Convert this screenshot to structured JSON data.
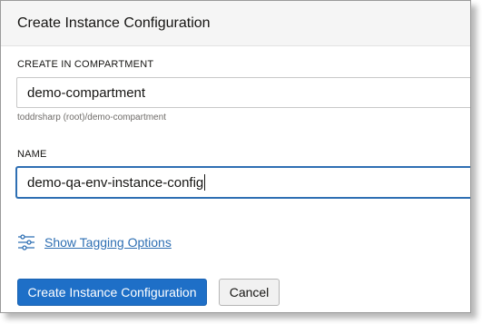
{
  "dialog": {
    "title": "Create Instance Configuration"
  },
  "compartment": {
    "label": "CREATE IN COMPARTMENT",
    "value": "demo-compartment",
    "path": "toddrsharp (root)/demo-compartment"
  },
  "name": {
    "label": "NAME",
    "value": "demo-qa-env-instance-config"
  },
  "tagging": {
    "link_label": "Show Tagging Options",
    "icon": "sliders-icon"
  },
  "actions": {
    "create_label": "Create Instance Configuration",
    "cancel_label": "Cancel"
  },
  "colors": {
    "primary": "#1e6fc7",
    "link": "#2e6fb3",
    "focus_border": "#2e6fb3",
    "header_bg": "#f5f5f5"
  }
}
